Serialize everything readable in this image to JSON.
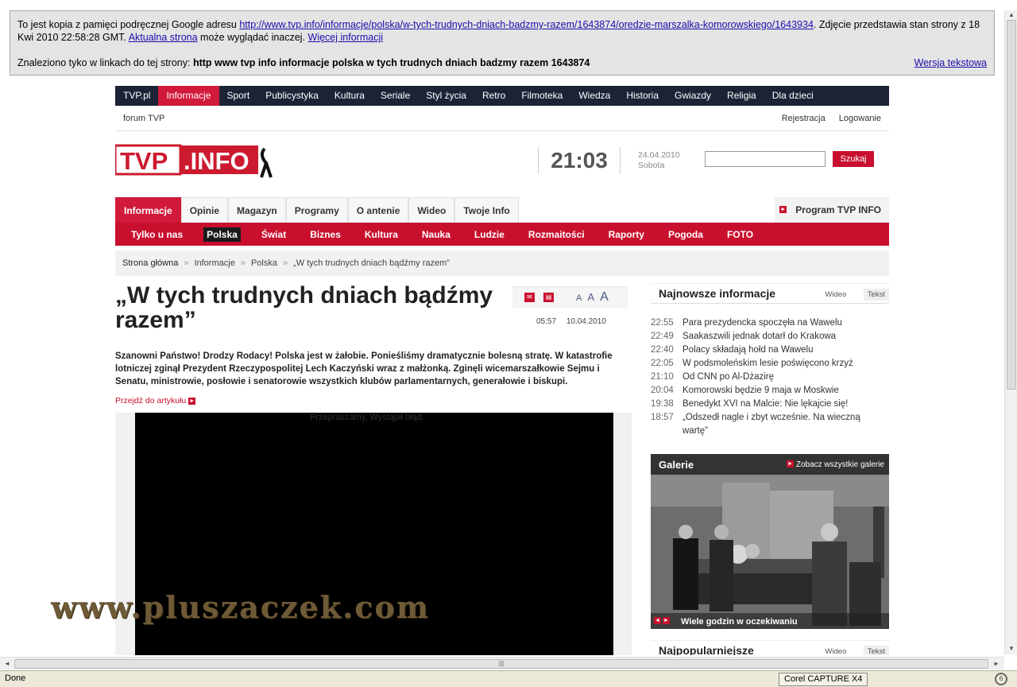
{
  "cache": {
    "intro": "To jest kopia z pamięci podręcznej Google adresu",
    "url": "http://www.tvp.info/informacje/polska/w-tych-trudnych-dniach-badzmy-razem/1643874/oredzie-marszalka-komorowskiego/1643934",
    "snapshot": ". Zdjęcie przedstawia stan strony z 18 Kwi 2010 22:58:28 GMT.",
    "current_link": "Aktualna strona",
    "may_differ": "może wyglądać inaczej.",
    "more_link": "Więcej informacji",
    "found_in": "Znaleziono tyko w linkach do tej strony:",
    "terms": "http www tvp info informacje polska w tych trudnych dniach badzmy razem 1643874",
    "text_version": "Wersja tekstowa"
  },
  "topnav": [
    "TVP.pl",
    "Informacje",
    "Sport",
    "Publicystyka",
    "Kultura",
    "Seriale",
    "Styl życia",
    "Retro",
    "Filmoteka",
    "Wiedza",
    "Historia",
    "Gwiazdy",
    "Religia",
    "Dla dzieci"
  ],
  "utilbar": {
    "forum": "forum TVP",
    "register": "Rejestracja",
    "login": "Logowanie"
  },
  "header": {
    "logo": "TVP.INFO",
    "time": "21:03",
    "date": "24.04.2010",
    "weekday": "Sobota",
    "search_button": "Szukaj"
  },
  "section_tabs": [
    "Informacje",
    "Opinie",
    "Magazyn",
    "Programy",
    "O antenie",
    "Wideo",
    "Twoje Info"
  ],
  "program": "Program TVP INFO",
  "subnav": [
    "Tylko u nas",
    "Polska",
    "Świat",
    "Biznes",
    "Kultura",
    "Nauka",
    "Ludzie",
    "Rozmaitości",
    "Raporty",
    "Pogoda",
    "FOTO"
  ],
  "breadcrumb": [
    "Strona główna",
    "Informacje",
    "Polska",
    "„W tych trudnych dniach bądźmy razem”"
  ],
  "article": {
    "title": "„W tych trudnych dniach bądźmy razem”",
    "time": "05:57",
    "date": "10.04.2010",
    "font_sizes": [
      "A",
      "A",
      "A"
    ],
    "lead": "Szanowni Państwo! Drodzy Rodacy! Polska jest w żałobie. Ponieśliśmy dramatycznie bolesną stratę. W katastrofie lotniczej zginął Prezydent Rzeczypospolitej Lech Kaczyński wraz z małżonką. Zginęli wicemarszałkowie Sejmu i Senatu, ministrowie, posłowie i senatorowie wszystkich klubów parlamentarnych, generałowie i biskupi.",
    "goto": "Przejdź do artykułu",
    "video_error": "Przepraszamy, Wystąpił błąd."
  },
  "latest": {
    "title": "Najnowsze informacje",
    "tab_video": "Wideo",
    "tab_text": "Tekst",
    "items": [
      {
        "time": "22:55",
        "text": "Para prezydencka spoczęła na Wawelu"
      },
      {
        "time": "22:49",
        "text": "Saakaszwili jednak dotarł do Krakowa"
      },
      {
        "time": "22:40",
        "text": "Polacy składają hołd na Wawelu"
      },
      {
        "time": "22:05",
        "text": "W podsmoleńskim lesie poświęcono krzyż"
      },
      {
        "time": "21:10",
        "text": "Od CNN po Al-Dżazirę"
      },
      {
        "time": "20:04",
        "text": "Komorowski będzie 9 maja w Moskwie"
      },
      {
        "time": "19:38",
        "text": "Benedykt XVI na Malcie: Nie lękajcie się!"
      },
      {
        "time": "18:57",
        "text": "„Odszedł nagle i zbyt wcześnie. Na wieczną wartę”"
      }
    ]
  },
  "gallery": {
    "title": "Galerie",
    "all": "Zobacz wszystkie galerie",
    "caption": "Wiele godzin w oczekiwaniu"
  },
  "popular": {
    "title": "Najpopularniejsze",
    "tab_video": "Wideo",
    "tab_text": "Tekst"
  },
  "watermark": "www.pluszaczek.com",
  "status": {
    "done": "Done",
    "capture": "Corel CAPTURE X4"
  },
  "colors": {
    "brand_red": "#c8102e",
    "nav_dark": "#1b2335"
  }
}
